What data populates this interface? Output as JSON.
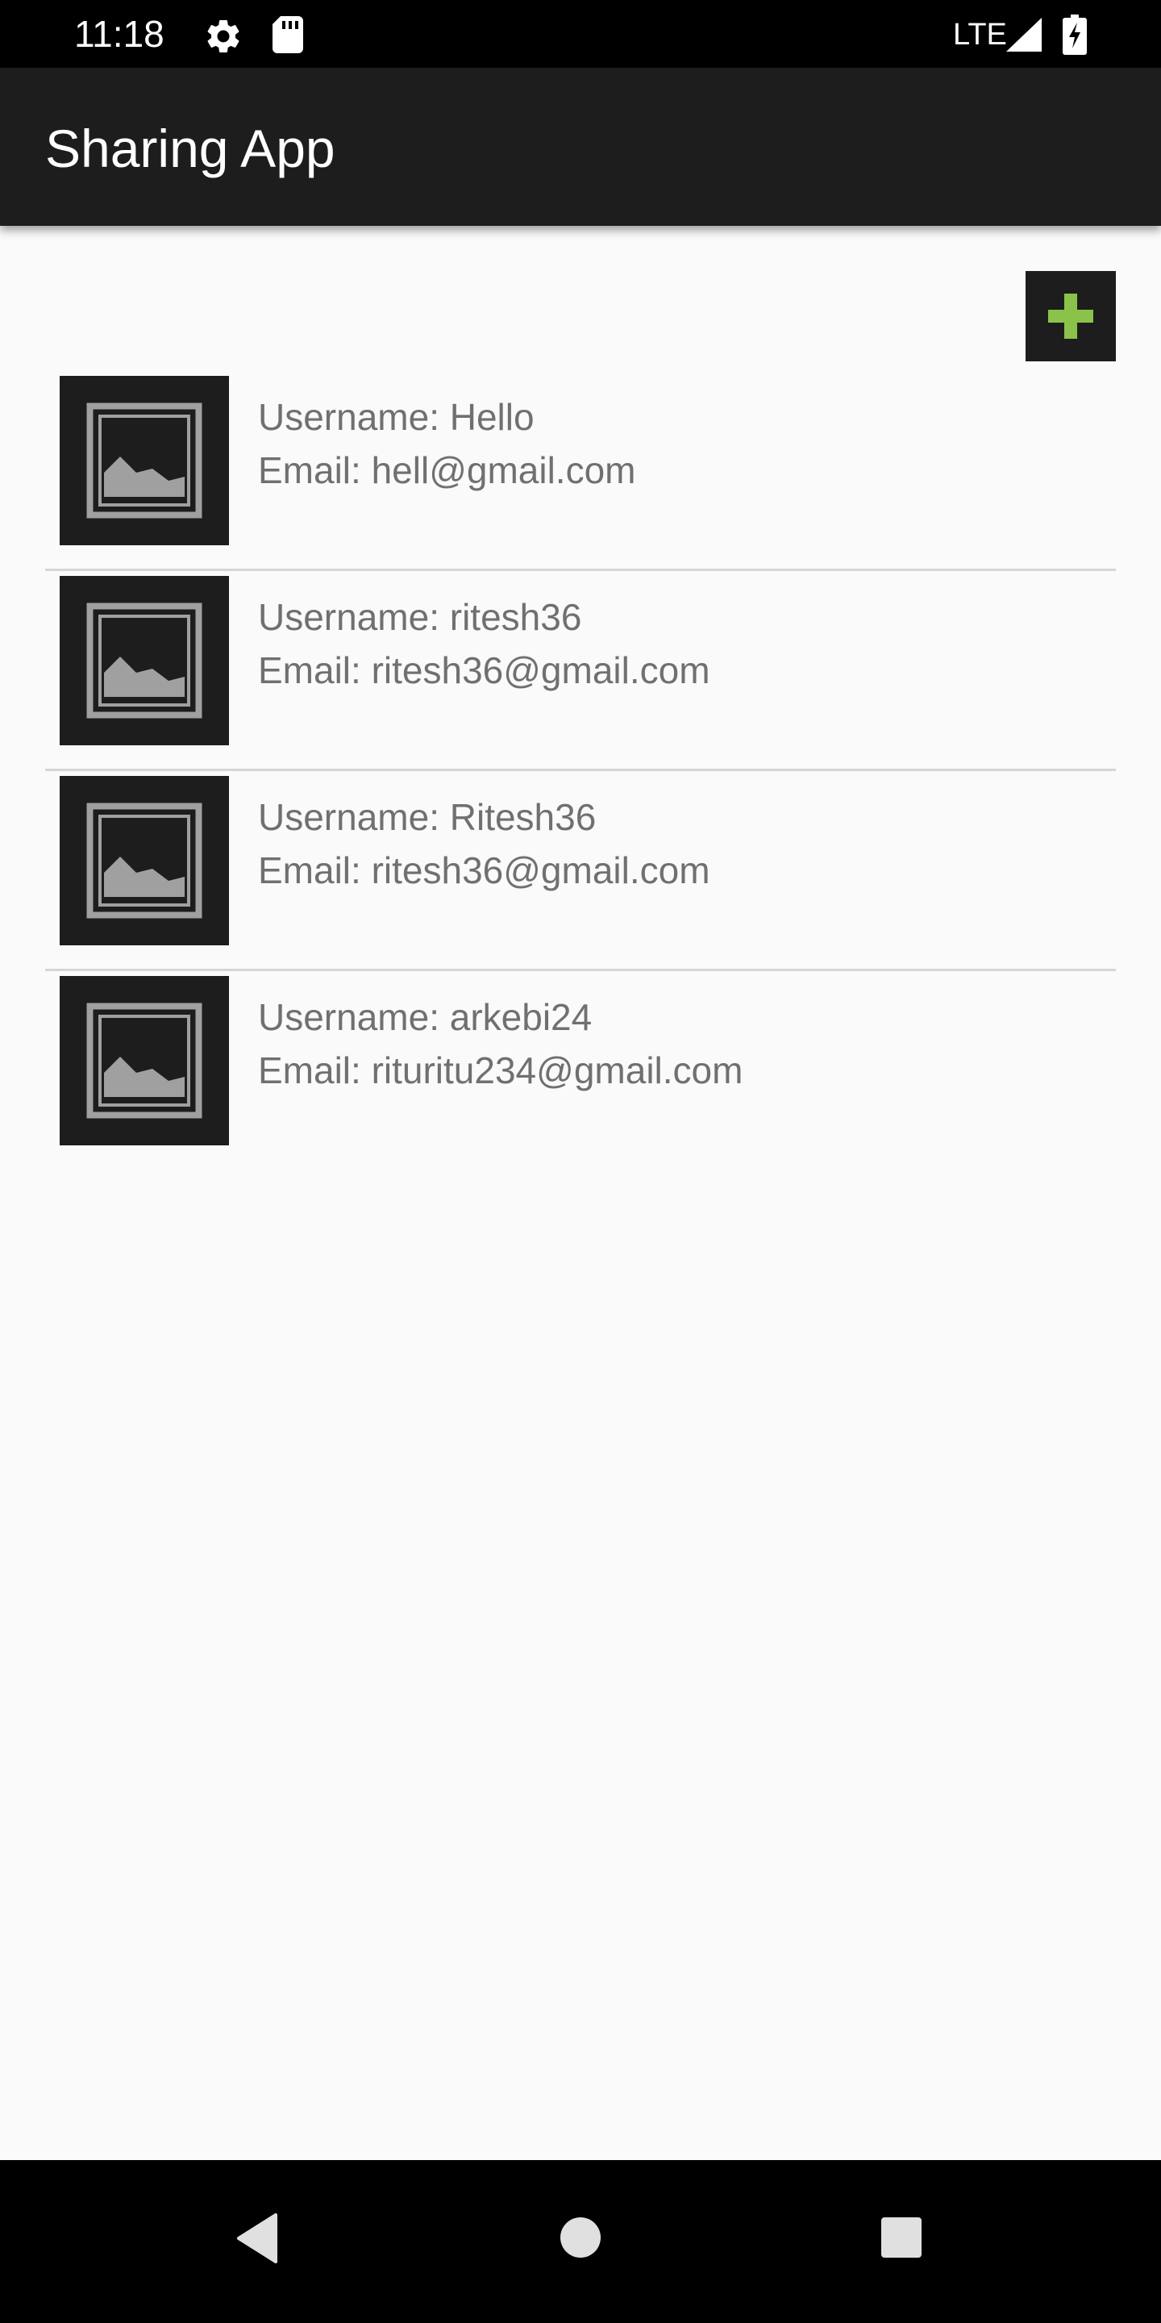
{
  "status_bar": {
    "time": "11:18",
    "network": "LTE",
    "icons": [
      "gear-icon",
      "sd-card-icon",
      "signal-icon",
      "battery-charging-icon"
    ]
  },
  "app_bar": {
    "title": "Sharing App",
    "background": "#1d1d1d"
  },
  "add_button": {
    "icon": "plus-icon",
    "icon_color": "#8bc34a"
  },
  "users": [
    {
      "username_line": "Username: Hello",
      "email_line": "Email: hell@gmail.com"
    },
    {
      "username_line": "Username: ritesh36",
      "email_line": "Email: ritesh36@gmail.com"
    },
    {
      "username_line": "Username: Ritesh36",
      "email_line": "Email: ritesh36@gmail.com"
    },
    {
      "username_line": "Username: arkebi24",
      "email_line": "Email: rituritu234@gmail.com"
    }
  ],
  "nav_bar": {
    "buttons": [
      "back-icon",
      "home-icon",
      "recents-icon"
    ]
  }
}
